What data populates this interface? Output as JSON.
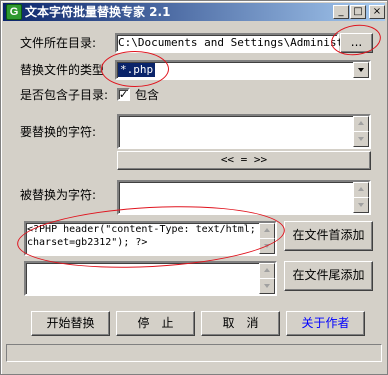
{
  "window": {
    "title": "文本字符批量替换专家 2.1",
    "icon": "app-icon-g",
    "icon_glyph": "G",
    "minimize_glyph": "_",
    "maximize_glyph": "□",
    "close_glyph": "×"
  },
  "folder": {
    "label": "文件所在目录:",
    "value": "C:\\Documents and Settings\\Administr",
    "browse_label": "..."
  },
  "filetype": {
    "label": "替换文件的类型",
    "value": "*.php"
  },
  "subdir": {
    "label": "是否包含子目录:",
    "checked": true,
    "check_glyph": "✓",
    "option_label": "包含"
  },
  "find": {
    "label": "要替换的字符:",
    "value": ""
  },
  "swap": {
    "label": "<< = >>"
  },
  "replace": {
    "label": "被替换为字符:",
    "value": ""
  },
  "prepend": {
    "value": "<?PHP header(\"content-Type: text/html; charset=gb2312\"); ?>",
    "button_label": "在文件首添加"
  },
  "append": {
    "value": "",
    "button_label": "在文件尾添加"
  },
  "actions": {
    "start_label": "开始替换",
    "stop_label": "停　止",
    "cancel_label": "取　消",
    "about_label": "关于作者"
  },
  "status": {
    "text": ""
  },
  "colors": {
    "annotation_red": "#e0141e",
    "title_bar": "#0a246a",
    "selection": "#0a246a",
    "about_text": "#0000ff"
  }
}
